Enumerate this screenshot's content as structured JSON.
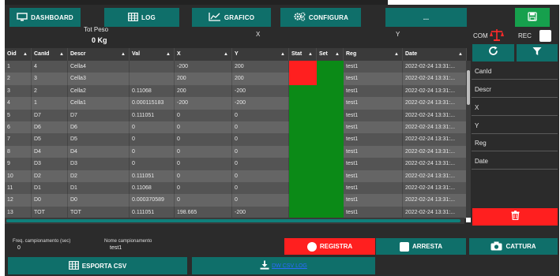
{
  "nav": {
    "dashboard": "DASHBOARD",
    "log": "LOG",
    "grafico": "GRAFICO",
    "configura": "CONFIGURA",
    "more": "..."
  },
  "weight": {
    "title": "Tot Peso",
    "value": "0 Kg"
  },
  "axes": {
    "x": "X",
    "y": "Y"
  },
  "com_label": "COM",
  "rec_label": "REC",
  "table": {
    "headers": [
      "Oid",
      "CanId",
      "Descr",
      "Val",
      "X",
      "Y",
      "Stat",
      "Set",
      "Reg",
      "Date"
    ],
    "rows": [
      {
        "oid": "1",
        "canid": "4",
        "descr": "Cella4",
        "val": "",
        "x": "-200",
        "y": "200",
        "stat": "red",
        "set": "green",
        "reg": "test1",
        "date": "2022-02-24 13:31:..."
      },
      {
        "oid": "2",
        "canid": "3",
        "descr": "Cella3",
        "val": "",
        "x": "200",
        "y": "200",
        "stat": "red",
        "set": "green",
        "reg": "test1",
        "date": "2022-02-24 13:31:..."
      },
      {
        "oid": "3",
        "canid": "2",
        "descr": "Cella2",
        "val": "0.11068",
        "x": "200",
        "y": "-200",
        "stat": "green",
        "set": "green",
        "reg": "test1",
        "date": "2022-02-24 13:31:..."
      },
      {
        "oid": "4",
        "canid": "1",
        "descr": "Cella1",
        "val": "0.000115183",
        "x": "-200",
        "y": "-200",
        "stat": "green",
        "set": "green",
        "reg": "test1",
        "date": "2022-02-24 13:31:..."
      },
      {
        "oid": "5",
        "canid": "D7",
        "descr": "D7",
        "val": "0.111051",
        "x": "0",
        "y": "0",
        "stat": "green",
        "set": "green",
        "reg": "test1",
        "date": "2022-02-24 13:31:..."
      },
      {
        "oid": "6",
        "canid": "D6",
        "descr": "D6",
        "val": "0",
        "x": "0",
        "y": "0",
        "stat": "green",
        "set": "green",
        "reg": "test1",
        "date": "2022-02-24 13:31:..."
      },
      {
        "oid": "7",
        "canid": "D5",
        "descr": "D5",
        "val": "0",
        "x": "0",
        "y": "0",
        "stat": "green",
        "set": "green",
        "reg": "test1",
        "date": "2022-02-24 13:31:..."
      },
      {
        "oid": "8",
        "canid": "D4",
        "descr": "D4",
        "val": "0",
        "x": "0",
        "y": "0",
        "stat": "green",
        "set": "green",
        "reg": "test1",
        "date": "2022-02-24 13:31:..."
      },
      {
        "oid": "9",
        "canid": "D3",
        "descr": "D3",
        "val": "0",
        "x": "0",
        "y": "0",
        "stat": "green",
        "set": "green",
        "reg": "test1",
        "date": "2022-02-24 13:31:..."
      },
      {
        "oid": "10",
        "canid": "D2",
        "descr": "D2",
        "val": "0.111051",
        "x": "0",
        "y": "0",
        "stat": "green",
        "set": "green",
        "reg": "test1",
        "date": "2022-02-24 13:31:..."
      },
      {
        "oid": "11",
        "canid": "D1",
        "descr": "D1",
        "val": "0.11068",
        "x": "0",
        "y": "0",
        "stat": "green",
        "set": "green",
        "reg": "test1",
        "date": "2022-02-24 13:31:..."
      },
      {
        "oid": "12",
        "canid": "D0",
        "descr": "D0",
        "val": "0.000370589",
        "x": "0",
        "y": "0",
        "stat": "green",
        "set": "green",
        "reg": "test1",
        "date": "2022-02-24 13:31:..."
      },
      {
        "oid": "13",
        "canid": "TOT",
        "descr": "TOT",
        "val": "0.111051",
        "x": "198.665",
        "y": "-200",
        "stat": "green",
        "set": "green",
        "reg": "test1",
        "date": "2022-02-24 13:31:..."
      }
    ]
  },
  "filters": [
    "CanId",
    "Descr",
    "X",
    "Y",
    "Reg",
    "Date"
  ],
  "bottom": {
    "freq_label": "Freq. campionamento (sec)",
    "freq_value": "0",
    "nome_label": "Nome campionamento",
    "nome_value": "test1",
    "registra": "REGISTRA",
    "arresta": "ARRESTA",
    "cattura": "CATTURA",
    "esporta": "ESPORTA CSV",
    "download_link": "DW CSV LOG"
  },
  "colors": {
    "accent": "#0f6f6a",
    "save": "#16a04d",
    "status_red": "#ff1f1f",
    "status_green": "#0b8a17",
    "background": "#2b2b2b"
  },
  "icons": {
    "dashboard": "monitor-icon",
    "log": "table-icon",
    "grafico": "chart-icon",
    "configura": "gears-icon",
    "save": "floppy-disk-icon",
    "com": "scale-icon",
    "refresh": "refresh-icon",
    "filter": "filter-icon",
    "delete": "trash-icon",
    "registra": "record-icon",
    "arresta": "stop-icon",
    "cattura": "camera-icon",
    "esporta": "table-icon",
    "download": "download-icon"
  }
}
